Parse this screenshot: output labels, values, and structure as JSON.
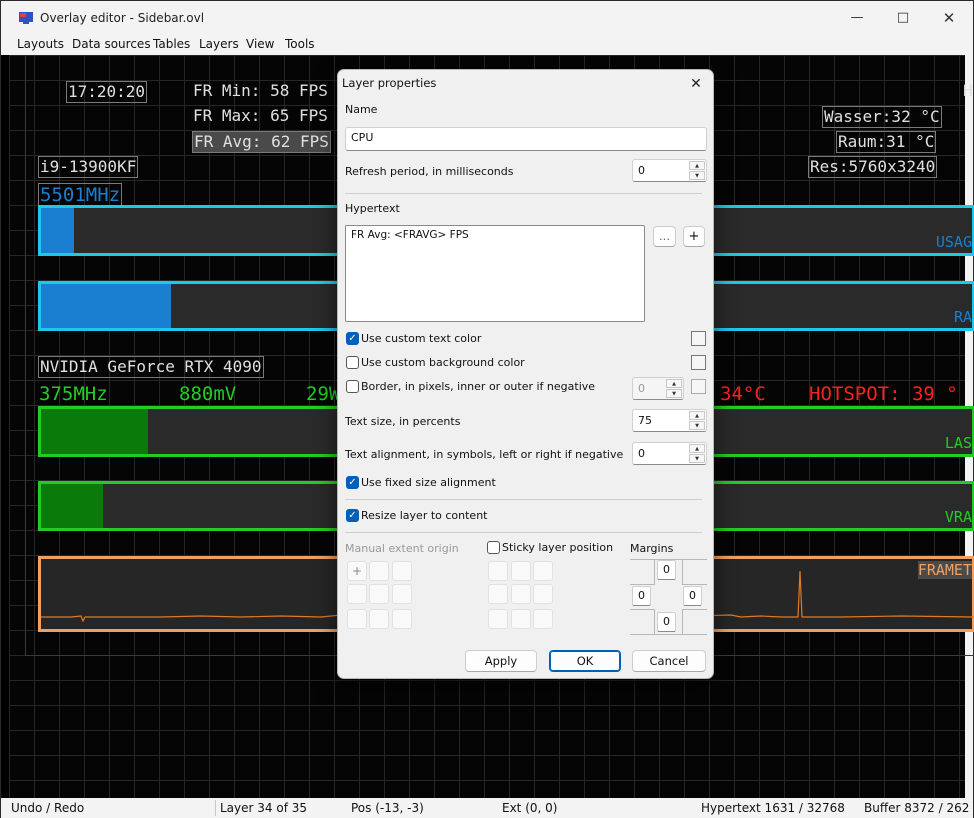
{
  "window": {
    "title": "Overlay editor - Sidebar.ovl",
    "min_icon": "minimize-icon",
    "max_icon": "maximize-icon",
    "close_icon": "close-icon"
  },
  "menu": [
    "Layouts",
    "Data sources",
    "Tables",
    "Layers",
    "View",
    "Tools"
  ],
  "overlay": {
    "time": "17:20:20",
    "fr_min": "FR Min: 58 FPS",
    "fr_max": "FR Max: 65 FPS",
    "fr_avg": "FR Avg: 62 FPS",
    "cpu_name": "i9-13900KF",
    "cpu_clock": "5501MHz",
    "cpu_usage_label": "USAG",
    "ram_label": "RA",
    "cpu_usage_fraction": 0.035,
    "ram_fraction": 0.14,
    "gpu_name": "NVIDIA GeForce RTX 4090",
    "gpu_clock": "375MHz",
    "gpu_voltage": "880mV",
    "gpu_power": "29W",
    "gpu_temp": "34°C",
    "hotspot": "HOTSPOT: 39 °",
    "gpu_load_label": "LAS",
    "vram_label": "VRA",
    "gpu_load_fraction": 0.115,
    "vram_fraction": 0.067,
    "frametime_label": "FRAMET",
    "top_right": "H",
    "water": "Wasser:32 °C",
    "room": "Raum:31 °C",
    "res": "Res:5760x3240",
    "colors": {
      "cyan": "#1fc8e6",
      "blue": "#1a7fd0",
      "green": "#22cc22",
      "darkgreen": "#0a7a0a",
      "red": "#ff2020",
      "orange": "#f0a060"
    }
  },
  "dialog": {
    "title": "Layer properties",
    "close_icon": "close-icon",
    "name_label": "Name",
    "name_value": "CPU",
    "refresh_label": "Refresh period, in milliseconds",
    "refresh_value": "0",
    "hypertext_label": "Hypertext",
    "hypertext_value": "FR Avg: <FRAVG> FPS",
    "ellipsis_btn": "...",
    "plus_btn": "+",
    "use_text_color": "Use custom text color",
    "use_bg_color": "Use custom background color",
    "border_label": "Border, in pixels, inner or outer if negative",
    "border_value": "0",
    "text_size_label": "Text size, in percents",
    "text_size_value": "75",
    "text_align_label": "Text alignment, in symbols, left or right if negative",
    "text_align_value": "0",
    "fixed_align": "Use fixed size alignment",
    "resize_layer": "Resize layer to content",
    "manual_origin": "Manual extent origin",
    "sticky": "Sticky layer position",
    "margins": "Margins",
    "margin_top": "0",
    "margin_left": "0",
    "margin_right": "0",
    "margin_bottom": "0",
    "origin_plus": "+",
    "apply": "Apply",
    "ok": "OK",
    "cancel": "Cancel"
  },
  "status": {
    "undo": "Undo / Redo",
    "layer": "Layer 34 of 35",
    "pos": "Pos (-13, -3)",
    "ext": "Ext (0, 0)",
    "hypertext": "Hypertext 1631 / 32768",
    "buffer": "Buffer 8372 / 262"
  }
}
